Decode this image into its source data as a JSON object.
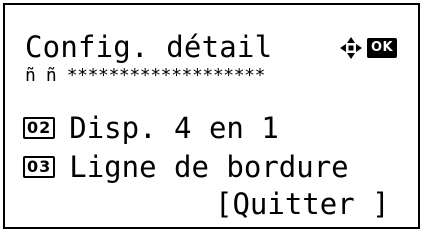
{
  "header": {
    "title": "Config. détail",
    "nav_icon": "four-way-arrow-icon",
    "ok_label": "OK"
  },
  "separator": "ñ ñ *******************",
  "menu": {
    "items": [
      {
        "number": "02",
        "label": "Disp. 4 en 1"
      },
      {
        "number": "03",
        "label": "Ligne de bordure"
      }
    ]
  },
  "softkey": {
    "quit_label": "[Quitter ]"
  },
  "colors": {
    "foreground": "#000000",
    "background": "#ffffff"
  }
}
